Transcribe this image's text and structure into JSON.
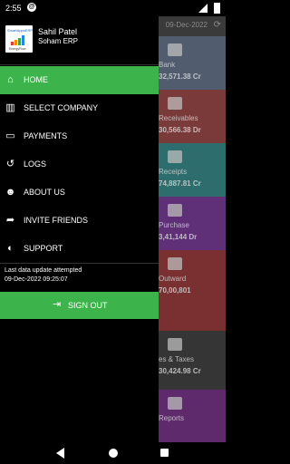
{
  "status": {
    "time": "2:55"
  },
  "background": {
    "date": "09-Dec-2022",
    "tiles": [
      {
        "label": "Bank",
        "value": "32,571.38 Cr",
        "color": "#515d6e",
        "icon": "bank-icon"
      },
      {
        "label": "Receivables",
        "value": "30,566.38 Dr",
        "color": "#7b3a3a",
        "icon": "receivables-icon"
      },
      {
        "label": "Receipts",
        "value": "74,887.81 Cr",
        "color": "#2d6d6e",
        "icon": "receipts-icon"
      },
      {
        "label": "Purchase",
        "value": "3,41,144 Dr",
        "color": "#5f2f78",
        "icon": "purchase-icon"
      },
      {
        "label": "Outward",
        "value": "70,00,801",
        "color": "#7a3030",
        "icon": "outward-icon"
      },
      {
        "label": "es & Taxes",
        "value": "30,424.98 Cr",
        "color": "#353535",
        "icon": "taxes-icon"
      },
      {
        "label": "Reports",
        "value": "",
        "color": "#5e2a6b",
        "icon": "reports-icon"
      }
    ]
  },
  "drawer": {
    "user_name": "Sahil Patel",
    "company_name": "Soham ERP",
    "logo_text_top": "SmartAppsERP",
    "logo_text_bottom": "EnergyFlow",
    "menu": [
      {
        "label": "HOME",
        "icon": "home-icon",
        "active": true
      },
      {
        "label": "SELECT COMPANY",
        "icon": "company-icon",
        "active": false
      },
      {
        "label": "PAYMENTS",
        "icon": "payments-icon",
        "active": false
      },
      {
        "label": "LOGS",
        "icon": "history-icon",
        "active": false
      },
      {
        "label": "ABOUT US",
        "icon": "people-icon",
        "active": false
      },
      {
        "label": "INVITE FRIENDS",
        "icon": "share-icon",
        "active": false
      },
      {
        "label": "SUPPORT",
        "icon": "headset-icon",
        "active": false
      }
    ],
    "last_update_label": "Last data update attempted",
    "last_update_datetime": "09-Dec-2022 09:25:07",
    "signout_label": "SIGN OUT"
  },
  "colors": {
    "accent": "#3cb44b",
    "drawer_bg": "#000000"
  }
}
